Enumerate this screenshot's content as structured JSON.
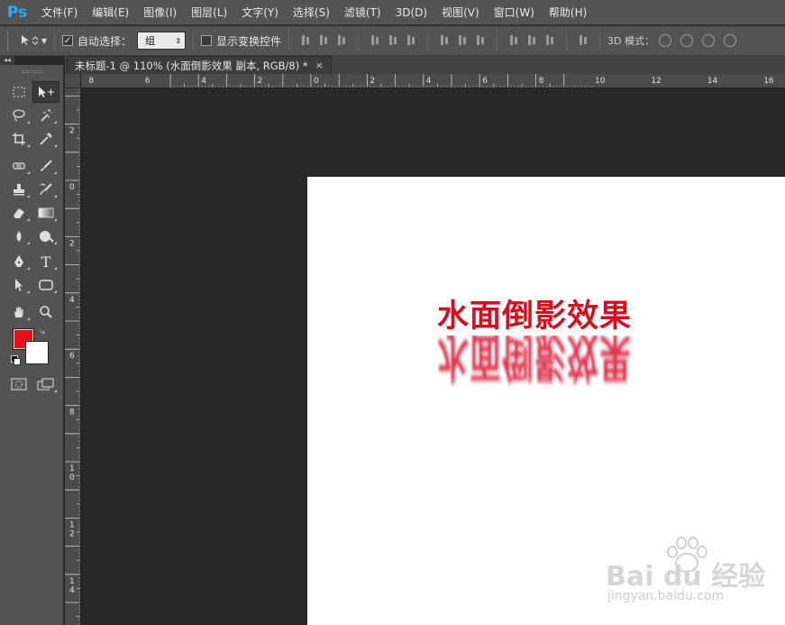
{
  "app": {
    "logo": "Ps"
  },
  "menu": [
    "文件(F)",
    "编辑(E)",
    "图像(I)",
    "图层(L)",
    "文字(Y)",
    "选择(S)",
    "滤镜(T)",
    "3D(D)",
    "视图(V)",
    "窗口(W)",
    "帮助(H)"
  ],
  "options": {
    "auto_select_label": "自动选择：",
    "auto_select_checked": true,
    "auto_select_value": "组",
    "show_transform_label": "显示变换控件",
    "show_transform_checked": false,
    "mode3d_label": "3D 模式："
  },
  "tools": {
    "collapse_glyph": "◂◂",
    "type_tool_glyph": "T"
  },
  "colors": {
    "foreground": "#e8111a",
    "background": "#ffffff",
    "accent": "#31a8ff"
  },
  "document": {
    "tab_title": "未标题-1 @ 110% (水面倒影效果 副本, RGB/8) *",
    "close_glyph": "×"
  },
  "rulers": {
    "horizontal_labels": [
      "8",
      "6",
      "4",
      "2",
      "0",
      "2",
      "4",
      "6",
      "8",
      "10",
      "12",
      "14",
      "16"
    ],
    "vertical_labels": [
      "2",
      "0",
      "2",
      "4",
      "6",
      "8",
      "10",
      "12",
      "14"
    ]
  },
  "canvas": {
    "text": "水面倒影效果",
    "reflection_text": "水面倒影效果"
  },
  "watermark": {
    "brand": "Bai du 经验",
    "url": "jingyan.baidu.com"
  }
}
